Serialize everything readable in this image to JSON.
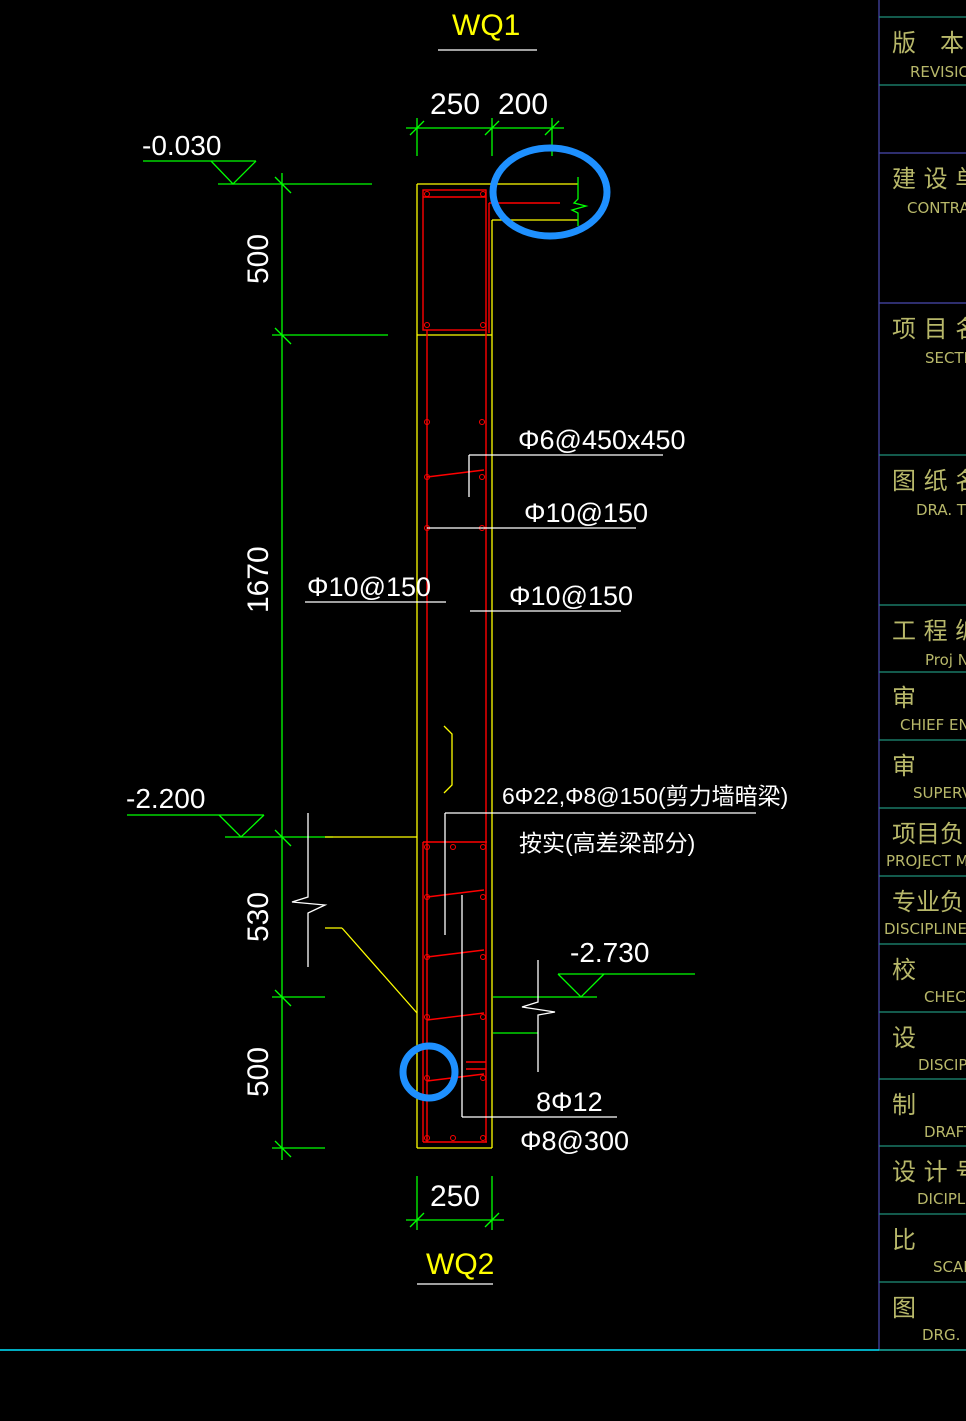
{
  "drawing": {
    "top_title": "WQ1",
    "bottom_title": "WQ2",
    "top_dims": [
      "250",
      "200"
    ],
    "bottom_dim": "250",
    "vertical_dims": [
      "500",
      "1670",
      "530",
      "500"
    ],
    "elevations": [
      "-0.030",
      "-2.200",
      "-2.730"
    ],
    "rebar_labels": {
      "tie": "Φ6@450x450",
      "horiz_right": "Φ10@150",
      "vert_right": "Φ10@150",
      "vert_left": "Φ10@150",
      "beam_line1": "6Φ22,Φ8@150(剪力墙暗梁)",
      "beam_line2": "按实(高差梁部分)",
      "bottom_main": "8Φ12",
      "bottom_stirrup": "Φ8@300"
    },
    "highlight_marks": [
      "highlight-circle-top",
      "highlight-circle-bottom"
    ],
    "colors": {
      "background": "#000000",
      "dimension": "#00ff00",
      "outline": "#ffff00",
      "rebar": "#ff0000",
      "text": "#ffffff",
      "highlight": "#1e90ff",
      "titleblock_text": "#b8b86a",
      "bottom_border": "#00e5ff"
    }
  },
  "title_block": {
    "rows": [
      {
        "cn": "版　本",
        "en": "REVISION"
      },
      {
        "cn": "",
        "en": ""
      },
      {
        "cn": "建 设 单",
        "en": "CONTRAC"
      },
      {
        "cn": "项 目 名",
        "en": "SECTIO"
      },
      {
        "cn": "图 纸 名",
        "en": "DRA. TI"
      },
      {
        "cn": "工 程 编",
        "en": "Proj N"
      },
      {
        "cn": "审",
        "en": "CHIEF ENG"
      },
      {
        "cn": "审",
        "en": "SUPERVI"
      },
      {
        "cn": "项目负",
        "en": "PROJECT MA"
      },
      {
        "cn": "专业负",
        "en": "DISCIPLINE M"
      },
      {
        "cn": "校",
        "en": "CHECK"
      },
      {
        "cn": "设",
        "en": "DISCIPL"
      },
      {
        "cn": "制",
        "en": "DRAFT"
      },
      {
        "cn": "设 计 号",
        "en": "DICIPLIN"
      },
      {
        "cn": "比",
        "en": "SCAL"
      },
      {
        "cn": "图",
        "en": "DRG. N"
      }
    ]
  }
}
